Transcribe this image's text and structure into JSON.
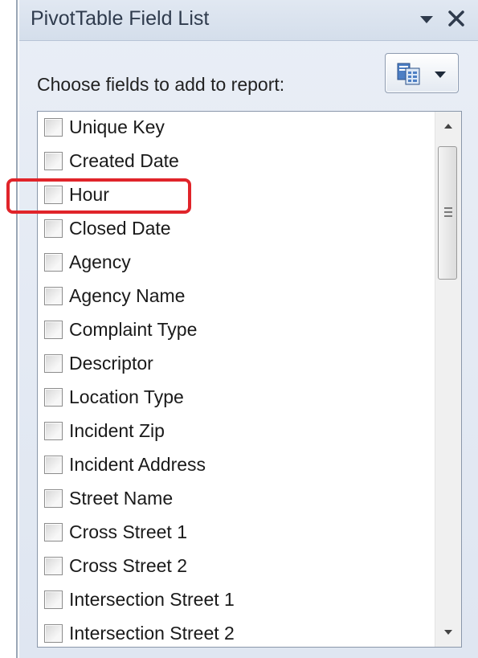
{
  "panel": {
    "title": "PivotTable Field List",
    "title_dropdown_icon": "triangle-down-icon",
    "close_icon": "close-x-icon"
  },
  "chooser": {
    "label": "Choose fields to add to report:",
    "layout_button_icon": "field-list-layout-icon"
  },
  "fields": [
    {
      "label": "Unique Key",
      "checked": false
    },
    {
      "label": "Created Date",
      "checked": false
    },
    {
      "label": "Hour",
      "checked": false,
      "highlighted": true
    },
    {
      "label": "Closed Date",
      "checked": false
    },
    {
      "label": "Agency",
      "checked": false
    },
    {
      "label": "Agency Name",
      "checked": false
    },
    {
      "label": "Complaint Type",
      "checked": false
    },
    {
      "label": "Descriptor",
      "checked": false
    },
    {
      "label": "Location Type",
      "checked": false
    },
    {
      "label": "Incident Zip",
      "checked": false
    },
    {
      "label": "Incident Address",
      "checked": false
    },
    {
      "label": "Street Name",
      "checked": false
    },
    {
      "label": "Cross Street 1",
      "checked": false
    },
    {
      "label": "Cross Street 2",
      "checked": false
    },
    {
      "label": "Intersection Street 1",
      "checked": false
    },
    {
      "label": "Intersection Street 2",
      "checked": false
    }
  ],
  "colors": {
    "highlight": "#e0242a",
    "pane_background": "#e4eaf3"
  }
}
